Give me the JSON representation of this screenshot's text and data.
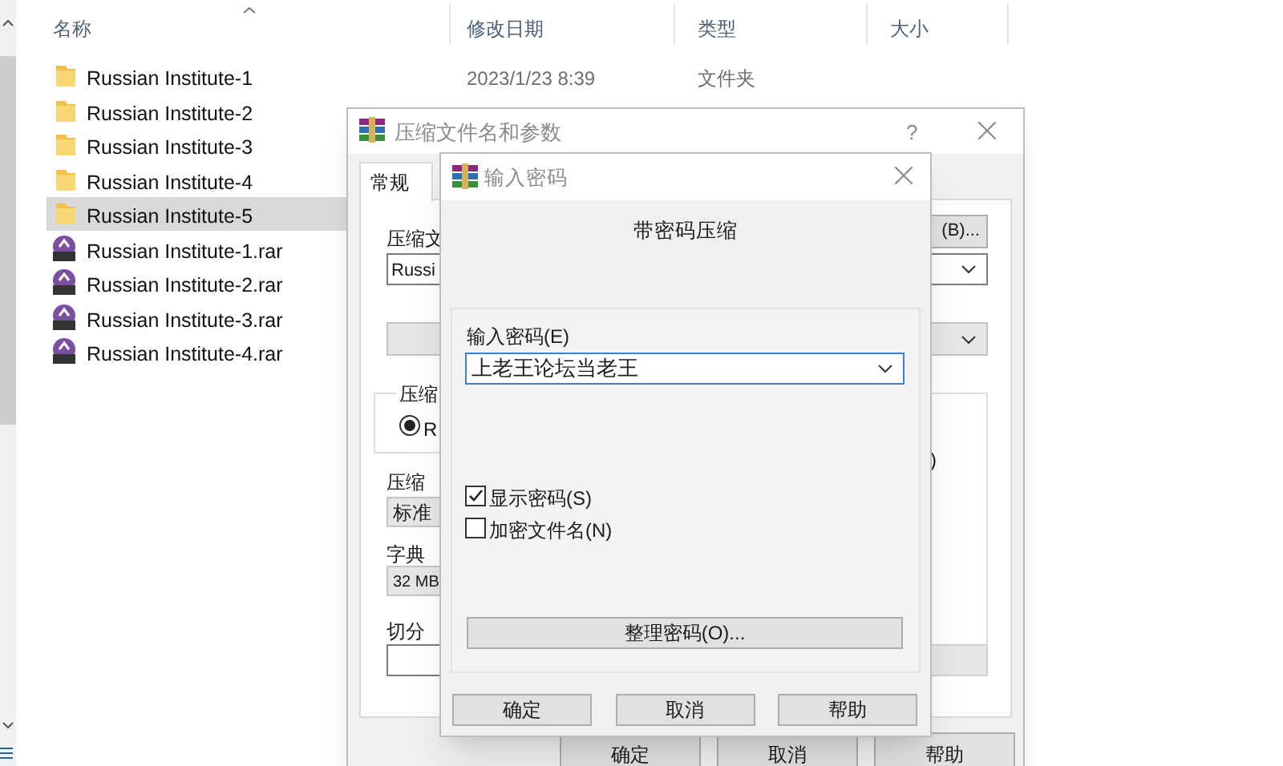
{
  "explorer": {
    "columns": [
      {
        "label": "名称",
        "sorted": true
      },
      {
        "label": "修改日期",
        "sorted": false
      },
      {
        "label": "类型",
        "sorted": false
      },
      {
        "label": "大小",
        "sorted": false
      }
    ],
    "rows": [
      {
        "kind": "folder",
        "name": "Russian Institute-1",
        "date": "2023/1/23 8:39",
        "type": "文件夹",
        "selected": false
      },
      {
        "kind": "folder",
        "name": "Russian Institute-2",
        "selected": false
      },
      {
        "kind": "folder",
        "name": "Russian Institute-3",
        "selected": false
      },
      {
        "kind": "folder",
        "name": "Russian Institute-4",
        "selected": false
      },
      {
        "kind": "folder",
        "name": "Russian Institute-5",
        "selected": true
      },
      {
        "kind": "rar",
        "name": "Russian Institute-1.rar",
        "selected": false
      },
      {
        "kind": "rar",
        "name": "Russian Institute-2.rar",
        "selected": false
      },
      {
        "kind": "rar",
        "name": "Russian Institute-3.rar",
        "selected": false
      },
      {
        "kind": "rar",
        "name": "Russian Institute-4.rar",
        "selected": false
      }
    ]
  },
  "archive_dialog": {
    "title": "压缩文件名和参数",
    "help": "?",
    "tabs": [
      {
        "label": "常规",
        "selected": true
      }
    ],
    "browse_button": "(B)...",
    "label_1": "压缩文",
    "archive_name": "Russi",
    "group_label": "压缩",
    "radio": {
      "label": "R",
      "selected": true
    },
    "label_2": "压缩",
    "method": "标准",
    "label_3": "字典",
    "dictionary": "32 MB",
    "label_4": "切分",
    "options_fragment": ")",
    "buttons": [
      "确定",
      "取消",
      "帮助"
    ]
  },
  "password_dialog": {
    "title": "输入密码",
    "heading": "带密码压缩",
    "password_label": "输入密码(E)",
    "password": "上老王论坛当老王",
    "options": [
      {
        "label": "显示密码(S)",
        "checked": true
      },
      {
        "label": "加密文件名(N)",
        "checked": false
      }
    ],
    "organize_button": "整理密码(O)...",
    "buttons": [
      "确定",
      "取消",
      "帮助"
    ]
  }
}
